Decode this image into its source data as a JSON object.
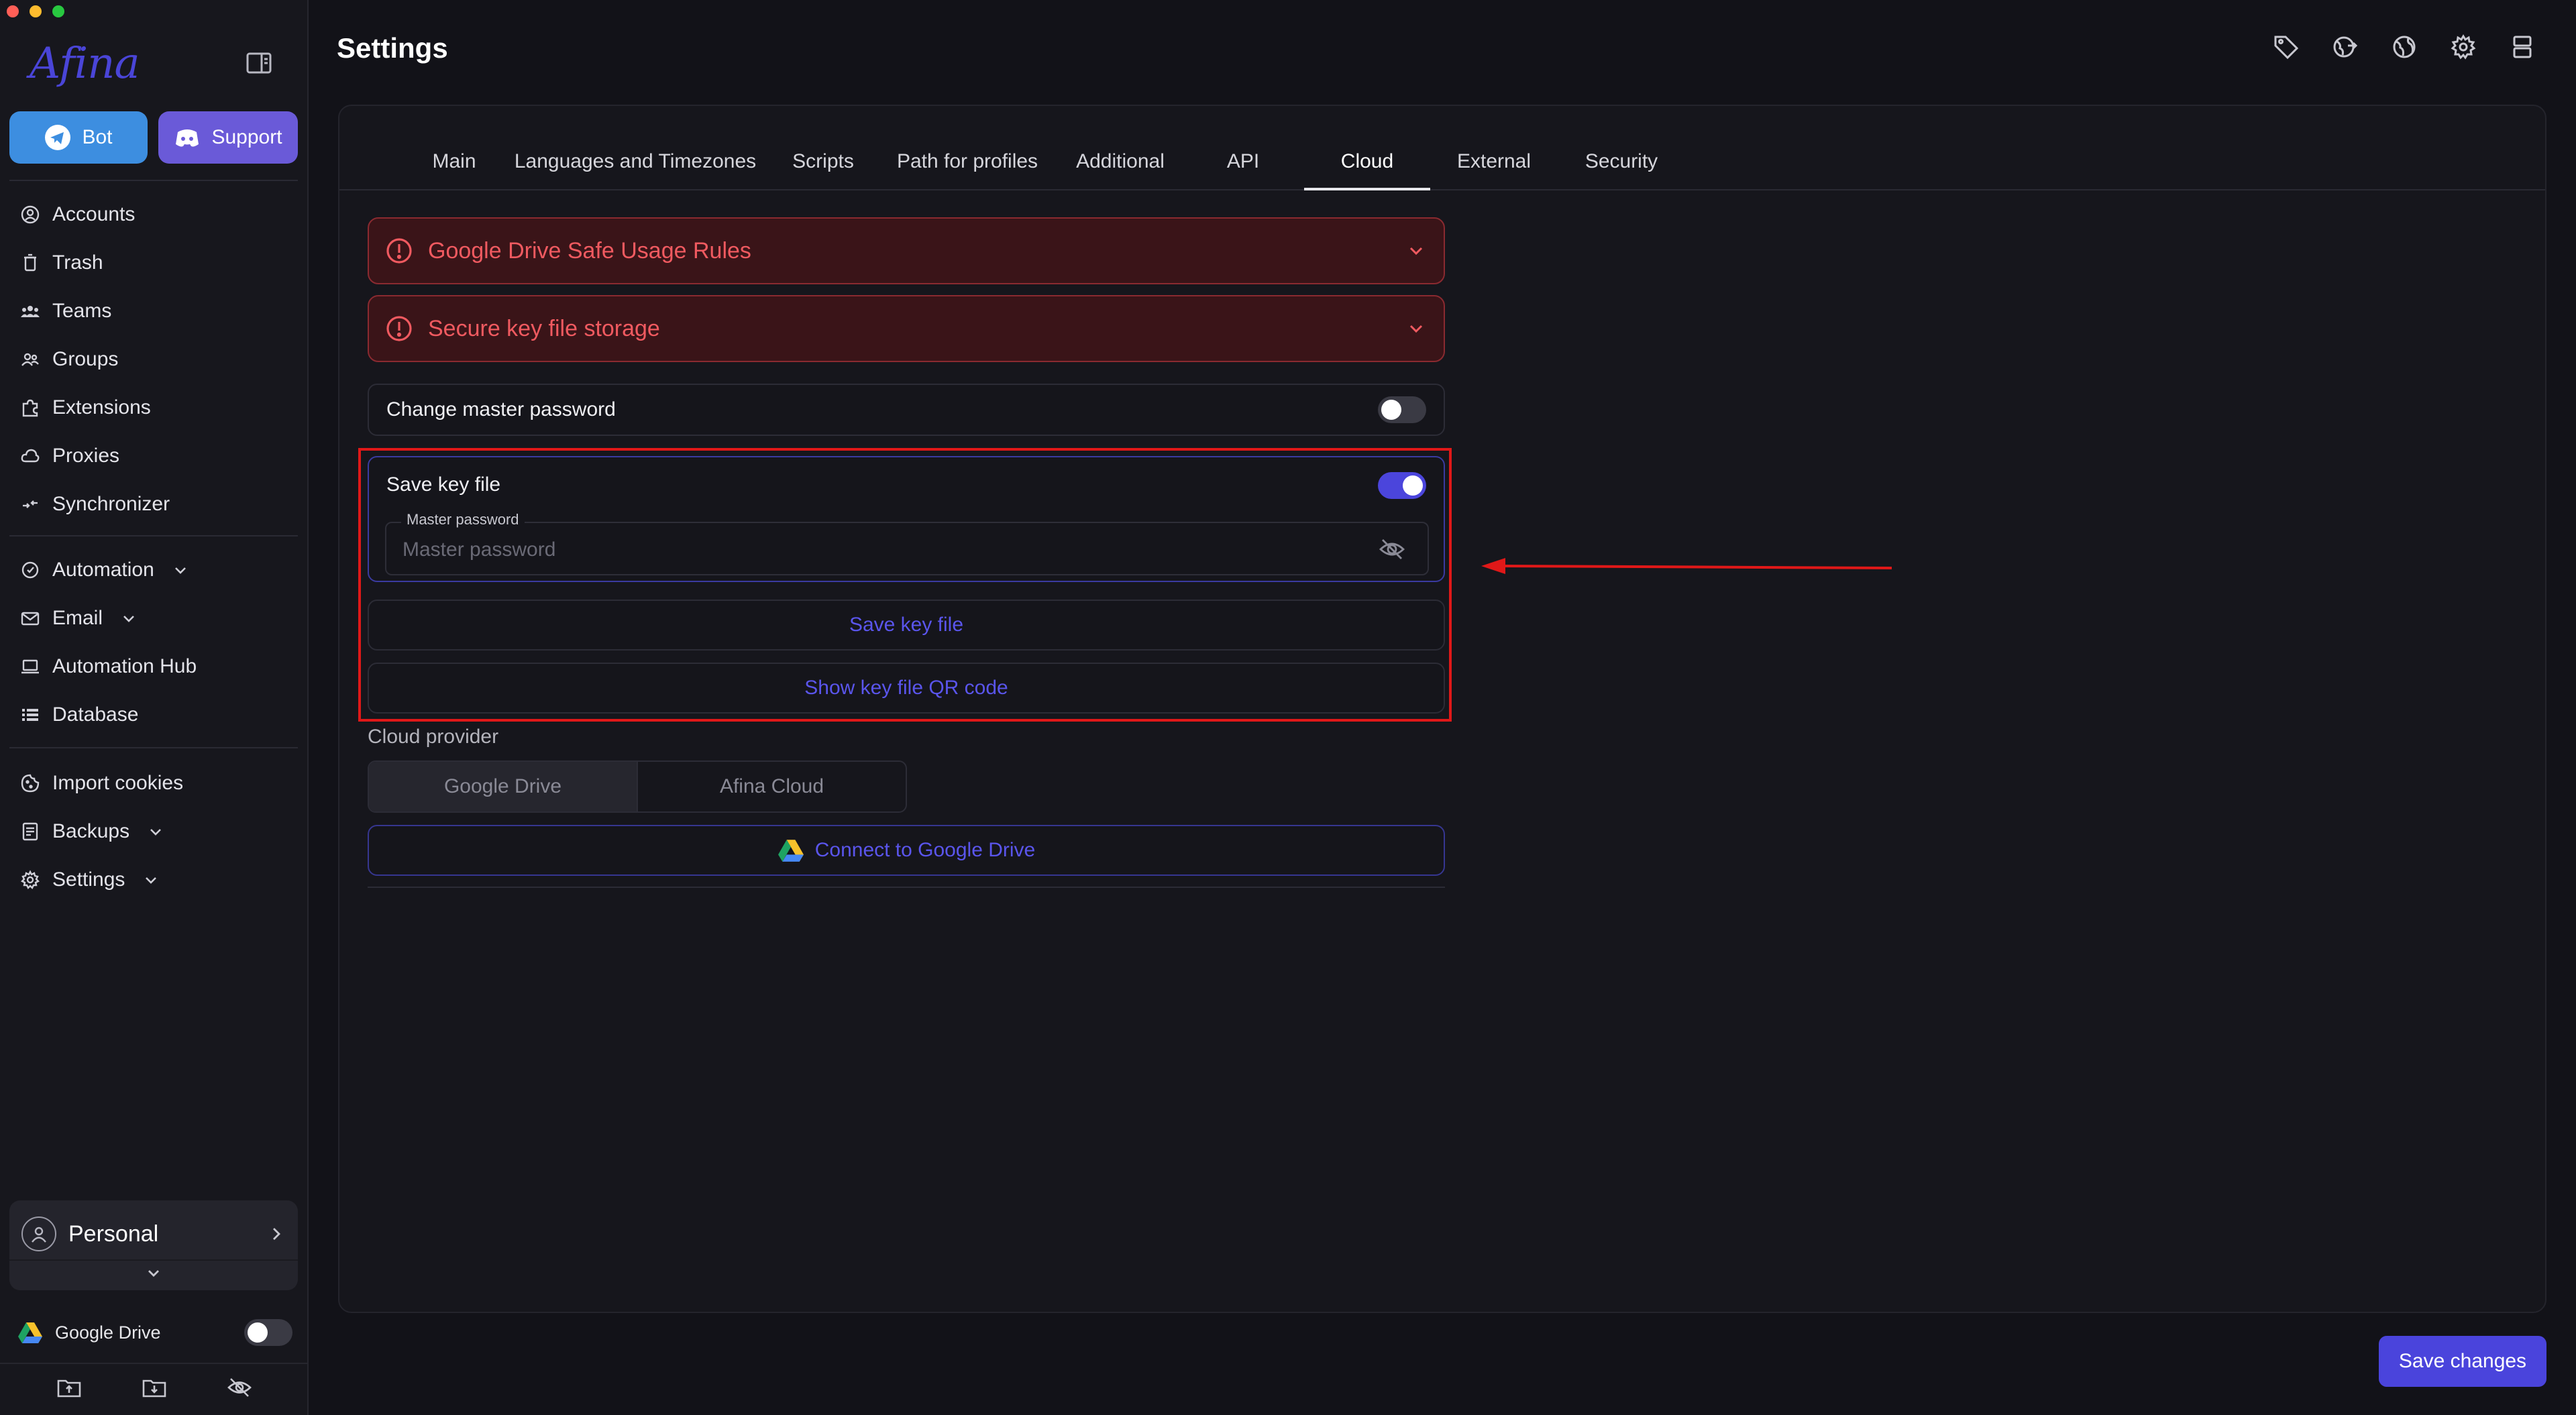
{
  "window": {
    "title": "Settings"
  },
  "brand": {
    "logo_text": "Afina",
    "accent": "#4b45dc"
  },
  "sidebar": {
    "bot_label": "Bot",
    "support_label": "Support",
    "nav_primary": [
      {
        "label": "Accounts",
        "icon": "user-circle-icon"
      },
      {
        "label": "Trash",
        "icon": "trash-icon"
      },
      {
        "label": "Teams",
        "icon": "teams-icon"
      },
      {
        "label": "Groups",
        "icon": "groups-icon"
      },
      {
        "label": "Extensions",
        "icon": "puzzle-icon"
      },
      {
        "label": "Proxies",
        "icon": "cloud-icon"
      },
      {
        "label": "Synchronizer",
        "icon": "sync-icon"
      }
    ],
    "nav_secondary": [
      {
        "label": "Automation",
        "icon": "automation-icon",
        "expandable": true
      },
      {
        "label": "Email",
        "icon": "mail-icon",
        "expandable": true
      },
      {
        "label": "Automation Hub",
        "icon": "laptop-icon",
        "expandable": false
      },
      {
        "label": "Database",
        "icon": "list-icon",
        "expandable": false
      }
    ],
    "nav_tertiary": [
      {
        "label": "Import cookies",
        "icon": "cookie-icon",
        "expandable": false
      },
      {
        "label": "Backups",
        "icon": "backup-icon",
        "expandable": true
      },
      {
        "label": "Settings",
        "icon": "gear-icon",
        "expandable": true
      }
    ],
    "profile": {
      "name": "Personal"
    },
    "google_drive": {
      "label": "Google Drive",
      "enabled": false
    }
  },
  "tabs": [
    "Main",
    "Languages and Timezones",
    "Scripts",
    "Path for profiles",
    "Additional",
    "API",
    "Cloud",
    "External",
    "Security"
  ],
  "active_tab": "Cloud",
  "cloud": {
    "alert_rules": "Google Drive Safe Usage Rules",
    "alert_storage": "Secure key file storage",
    "change_master_password": {
      "label": "Change master password",
      "enabled": false
    },
    "save_key_file_toggle": {
      "label": "Save key file",
      "enabled": true
    },
    "master_password": {
      "legend": "Master password",
      "placeholder": "Master password",
      "value": ""
    },
    "save_key_file_button": "Save key file",
    "show_qr_button": "Show key file QR code",
    "provider_label": "Cloud provider",
    "providers": [
      "Google Drive",
      "Afina Cloud"
    ],
    "selected_provider": "Google Drive",
    "connect_button": "Connect to Google Drive"
  },
  "footer": {
    "save_changes": "Save changes"
  },
  "annotation": {
    "highlight_color": "#e01818"
  }
}
